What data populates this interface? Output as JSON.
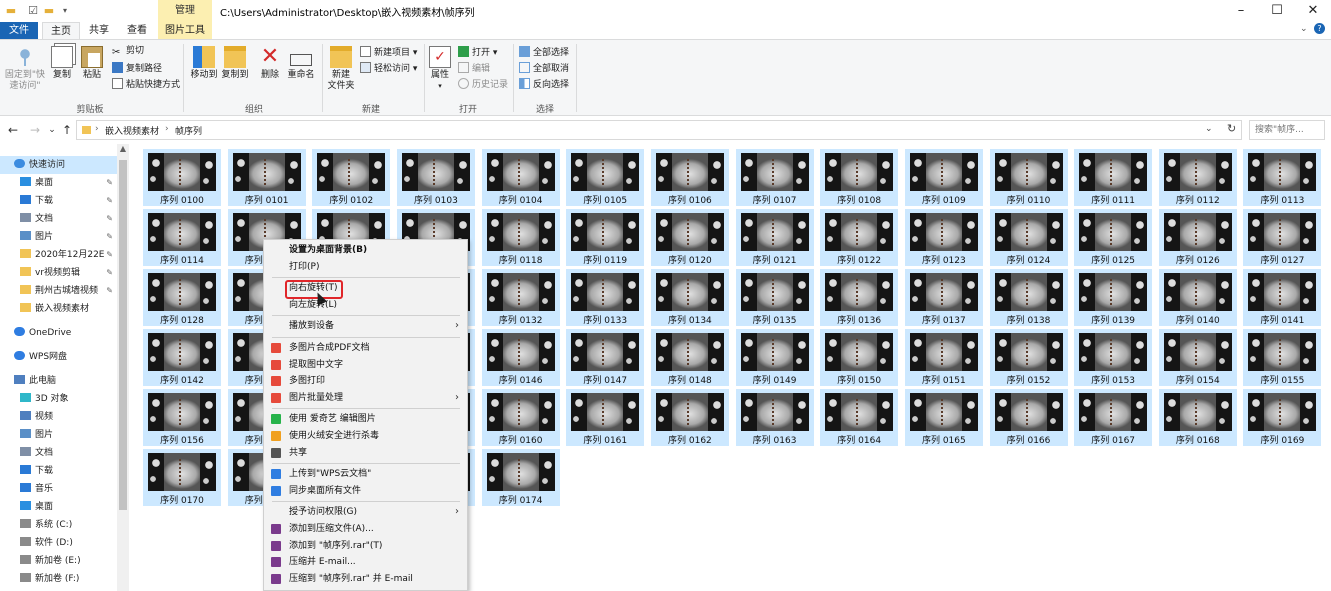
{
  "titlebar": {
    "path": "C:\\Users\\Administrator\\Desktop\\嵌入视频素材\\帧序列",
    "manage_tab": "管理",
    "quick_access": [
      "folder-icon",
      "check-icon",
      "folder-icon",
      "dropdown-icon"
    ],
    "controls": {
      "minimize": "–",
      "maximize": "☐",
      "close": "✕"
    }
  },
  "tabs": {
    "file": "文件",
    "home": "主页",
    "share": "共享",
    "view": "查看",
    "picture_tools": "图片工具"
  },
  "ribbon": {
    "clipboard": {
      "pin": "固定到\"快速访问\"",
      "copy": "复制",
      "paste": "粘贴",
      "cut": "剪切",
      "copy_path": "复制路径",
      "paste_shortcut": "粘贴快捷方式",
      "label": "剪贴板"
    },
    "organize": {
      "move_to": "移动到",
      "copy_to": "复制到",
      "delete": "删除",
      "rename": "重命名",
      "label": "组织"
    },
    "new": {
      "new_folder": "新建\n文件夹",
      "new_item": "新建项目",
      "easy_access": "轻松访问",
      "label": "新建"
    },
    "open": {
      "properties": "属性",
      "open": "打开",
      "edit": "编辑",
      "history": "历史记录",
      "label": "打开"
    },
    "select": {
      "select_all": "全部选择",
      "select_none": "全部取消",
      "invert": "反向选择",
      "label": "选择"
    }
  },
  "address": {
    "back": "←",
    "forward": "→",
    "recent": "⌄",
    "up": "↑",
    "crumbs": [
      "嵌入视频素材",
      "帧序列"
    ],
    "separator": "›",
    "dropdown": "⌄",
    "refresh": "↻",
    "search_placeholder": "搜索\"帧序..."
  },
  "navpane": {
    "items": [
      {
        "label": "快速访问",
        "icon": "star-icon",
        "selected": true
      },
      {
        "label": "桌面",
        "icon": "desktop-icon",
        "pinned": true
      },
      {
        "label": "下载",
        "icon": "download-icon",
        "pinned": true
      },
      {
        "label": "文档",
        "icon": "document-icon",
        "pinned": true
      },
      {
        "label": "图片",
        "icon": "picture-icon",
        "pinned": true
      },
      {
        "label": "2020年12月22E",
        "icon": "folder-icon",
        "pinned": true
      },
      {
        "label": "vr视频剪辑",
        "icon": "folder-icon",
        "pinned": true
      },
      {
        "label": "荆州古城墙视频",
        "icon": "folder-icon",
        "pinned": true
      },
      {
        "label": "嵌入视频素材",
        "icon": "folder-icon"
      },
      {
        "label": "OneDrive",
        "icon": "cloud-icon"
      },
      {
        "label": "WPS网盘",
        "icon": "cloud-icon"
      },
      {
        "label": "此电脑",
        "icon": "computer-icon"
      },
      {
        "label": "3D 对象",
        "icon": "cube-icon"
      },
      {
        "label": "视频",
        "icon": "video-icon"
      },
      {
        "label": "图片",
        "icon": "picture-icon"
      },
      {
        "label": "文档",
        "icon": "document-icon"
      },
      {
        "label": "下载",
        "icon": "download-icon"
      },
      {
        "label": "音乐",
        "icon": "music-icon"
      },
      {
        "label": "桌面",
        "icon": "desktop-icon"
      },
      {
        "label": "系统 (C:)",
        "icon": "drive-icon"
      },
      {
        "label": "软件 (D:)",
        "icon": "drive-icon"
      },
      {
        "label": "新加卷 (E:)",
        "icon": "drive-icon"
      },
      {
        "label": "新加卷 (F:)",
        "icon": "drive-icon"
      }
    ]
  },
  "files": {
    "prefix": "序列 ",
    "first": 100,
    "last": 174
  },
  "context_menu": {
    "items": [
      {
        "label": "设置为桌面背景(B)",
        "bold": true
      },
      {
        "label": "打印(P)"
      },
      {
        "sep": true
      },
      {
        "label": "向右旋转(T)",
        "highlight": true
      },
      {
        "label": "向左旋转(L)"
      },
      {
        "sep": true
      },
      {
        "label": "播放到设备",
        "submenu": true
      },
      {
        "sep": true
      },
      {
        "label": "多图片合成PDF文档",
        "icon": "pdf-icon",
        "color": "#e64a3b"
      },
      {
        "label": "提取图中文字",
        "icon": "ocr-icon",
        "color": "#e64a3b"
      },
      {
        "label": "多图打印",
        "icon": "print-icon",
        "color": "#e64a3b"
      },
      {
        "label": "图片批量处理",
        "icon": "batch-icon",
        "color": "#e64a3b",
        "submenu": true
      },
      {
        "sep": true
      },
      {
        "label": "使用 爱奇艺 编辑图片",
        "icon": "iqiyi-icon",
        "color": "#27b34b"
      },
      {
        "label": "使用火绒安全进行杀毒",
        "icon": "huorong-icon",
        "color": "#f0a020"
      },
      {
        "label": "共享",
        "icon": "share-icon",
        "color": "#555555"
      },
      {
        "sep": true
      },
      {
        "label": "上传到\"WPS云文档\"",
        "icon": "wps-cloud-icon",
        "color": "#2f7de1"
      },
      {
        "label": "同步桌面所有文件",
        "icon": "sync-icon",
        "color": "#2f7de1"
      },
      {
        "sep": true
      },
      {
        "label": "授予访问权限(G)",
        "submenu": true
      },
      {
        "label": "添加到压缩文件(A)...",
        "icon": "winrar-icon",
        "color": "#7a3a8c"
      },
      {
        "label": "添加到 \"帧序列.rar\"(T)",
        "icon": "winrar-icon",
        "color": "#7a3a8c"
      },
      {
        "label": "压缩并 E-mail...",
        "icon": "winrar-icon",
        "color": "#7a3a8c"
      },
      {
        "label": "压缩到 \"帧序列.rar\" 并 E-mail",
        "icon": "winrar-icon",
        "color": "#7a3a8c"
      }
    ]
  },
  "colors": {
    "file_tab": "#1a65b4",
    "selection": "#cce8ff",
    "manage_tab": "#fcefb1",
    "highlight_box": "#e0262a"
  }
}
